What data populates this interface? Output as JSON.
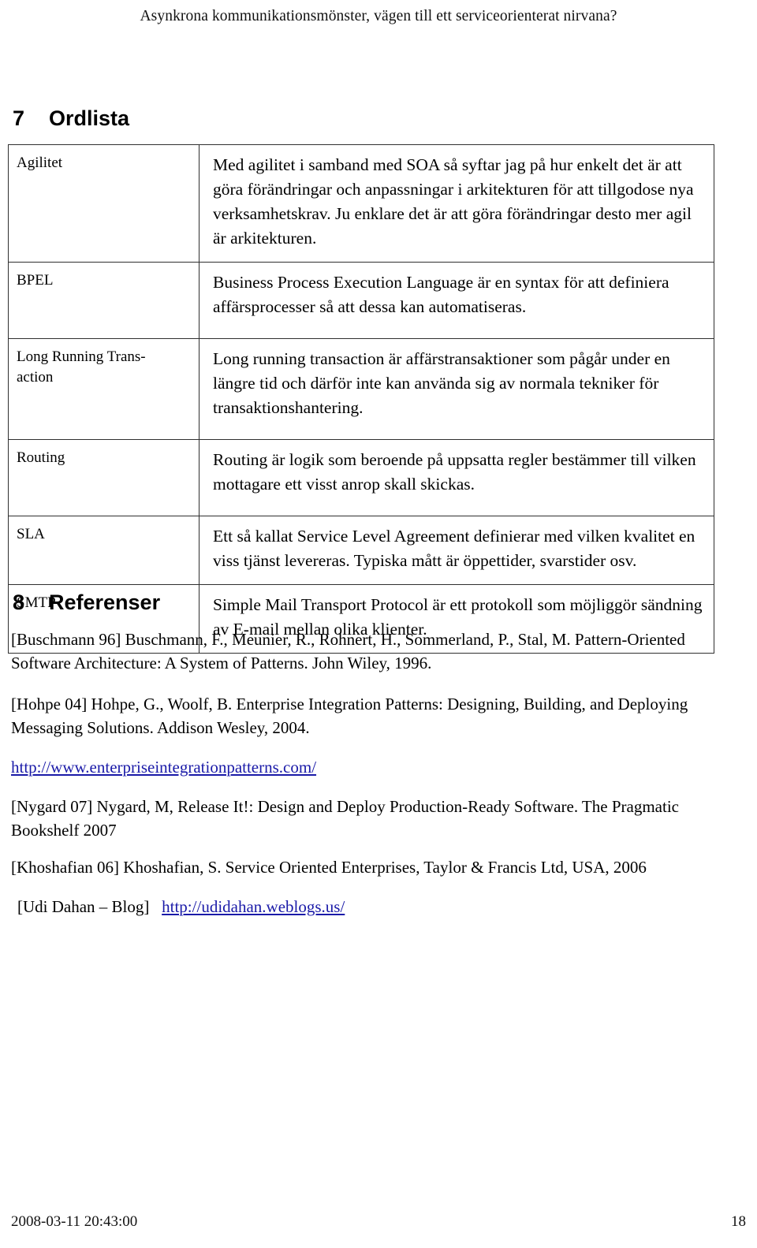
{
  "header": {
    "running_title": "Asynkrona kommunikationsmönster, vägen till ett serviceorienterat nirvana?"
  },
  "sections": [
    {
      "number": "7",
      "title": "Ordlista"
    },
    {
      "number": "8",
      "title": "Referenser"
    }
  ],
  "glossary": {
    "rows": [
      {
        "term": "Agilitet",
        "definition": "Med agilitet i samband med SOA så syftar jag på hur enkelt det är att göra förändringar och anpassningar i arkitekturen för att tillgodose nya verksamhetskrav. Ju enklare det är att göra förändringar desto mer agil är arkitekturen."
      },
      {
        "term": "BPEL",
        "definition": "Business Process Execution Language är en syntax för att definiera affärsprocesser så att dessa kan automatiseras."
      },
      {
        "term": "Long Running Trans-\naction",
        "definition": "Long running transaction är affärstransaktioner som pågår under en längre tid och därför inte kan använda sig av normala tekniker för transaktionshantering."
      },
      {
        "term": "Routing",
        "definition": "Routing är logik som beroende på uppsatta regler bestämmer till vilken mottagare ett visst anrop skall skickas."
      },
      {
        "term": "SLA",
        "definition": "Ett så kallat Service Level Agreement definierar med vilken kvalitet en viss tjänst levereras. Typiska mått är öppettider, svarstider osv."
      },
      {
        "term": "SMTP",
        "definition": "Simple Mail Transport Protocol är ett protokoll som möjliggör sändning av E-mail mellan olika klienter."
      }
    ]
  },
  "references": {
    "entries": [
      "[Buschmann 96] Buschmann, F., Meunier, R., Rohnert, H., Sommerland, P., Stal, M. Pattern-Oriented Software Architecture: A System of Patterns. John Wiley, 1996.",
      "[Hohpe 04] Hohpe, G., Woolf, B. Enterprise Integration Patterns: Designing, Building, and Deploying Messaging Solutions. Addison Wesley, 2004.",
      "[Nygard 07] Nygard, M, Release It!: Design and Deploy Production-Ready Software. The Pragmatic Bookshelf 2007",
      "[Khoshafian 06] Khoshafian, S. Service Oriented Enterprises, Taylor & Francis Ltd, USA, 2006"
    ],
    "standalone_link": "http://www.enterpriseintegrationpatterns.com/",
    "blog_entry": {
      "label": "[Udi Dahan – Blog]",
      "link": "http://udidahan.weblogs.us/"
    }
  },
  "footer": {
    "timestamp": "2008-03-11 20:43:00",
    "page_number": "18"
  },
  "colors": {
    "link": "#1a1aa8",
    "text": "#000000",
    "table_border": "#2f2f2f"
  }
}
